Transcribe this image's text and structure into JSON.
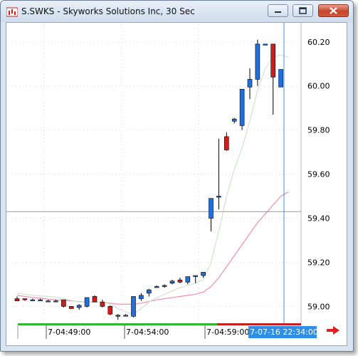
{
  "window": {
    "title": "S.SWKS - Skyworks Solutions Inc, 30 Sec",
    "controls": [
      "minimize",
      "maximize",
      "close"
    ]
  },
  "colors": {
    "up_candle": "#1f6fe0",
    "down_candle": "#d21c1c",
    "ma_fast": "#cfe3cf",
    "ma_slow": "#f08cb4",
    "crosshair_horizontal": "#8a8a8a",
    "cursor_vertical": "#3b8fd8",
    "session_bar_green": "#2dbb2d",
    "session_bar_red": "#c91f1f",
    "cursor_time_bg": "#2f8ee6"
  },
  "chart_data": {
    "type": "candlestick",
    "title": "S.SWKS - Skyworks Solutions Inc, 30 Sec",
    "y_ticks": [
      "60.20",
      "60.00",
      "59.80",
      "59.60",
      "59.40",
      "59.20",
      "59.00"
    ],
    "y_tick_values": [
      60.2,
      60.0,
      59.8,
      59.6,
      59.4,
      59.2,
      59.0
    ],
    "ylim": [
      58.93,
      60.28
    ],
    "x_tick_labels": [
      "7-04:49:00",
      "7-04:54:00",
      "7-04:59:00"
    ],
    "x_tick_index": [
      4,
      14,
      24
    ],
    "cursor_time_label": "7-07-16 22:34:00",
    "crosshair_price": 59.43,
    "candles": [
      {
        "o": 59.035,
        "h": 59.045,
        "l": 59.025,
        "c": 59.025
      },
      {
        "o": 59.035,
        "h": 59.035,
        "l": 59.025,
        "c": 59.03
      },
      {
        "o": 59.03,
        "h": 59.035,
        "l": 59.025,
        "c": 59.03
      },
      {
        "o": 59.03,
        "h": 59.035,
        "l": 59.025,
        "c": 59.03
      },
      {
        "o": 59.025,
        "h": 59.03,
        "l": 59.025,
        "c": 59.025
      },
      {
        "o": 59.025,
        "h": 59.03,
        "l": 59.02,
        "c": 59.025
      },
      {
        "o": 59.03,
        "h": 59.03,
        "l": 58.995,
        "c": 59.0
      },
      {
        "o": 59.0,
        "h": 59.0,
        "l": 58.99,
        "c": 58.99
      },
      {
        "o": 58.995,
        "h": 59.01,
        "l": 58.985,
        "c": 59.005
      },
      {
        "o": 59.0,
        "h": 59.04,
        "l": 58.995,
        "c": 59.04
      },
      {
        "o": 59.045,
        "h": 59.05,
        "l": 59.02,
        "c": 59.02
      },
      {
        "o": 59.02,
        "h": 59.03,
        "l": 58.995,
        "c": 59.0
      },
      {
        "o": 59.0,
        "h": 59.005,
        "l": 58.96,
        "c": 58.965
      },
      {
        "o": 58.96,
        "h": 58.965,
        "l": 58.94,
        "c": 58.955
      },
      {
        "o": 58.96,
        "h": 58.965,
        "l": 58.955,
        "c": 58.96
      },
      {
        "o": 58.955,
        "h": 59.045,
        "l": 58.95,
        "c": 59.045
      },
      {
        "o": 59.035,
        "h": 59.06,
        "l": 59.025,
        "c": 59.05
      },
      {
        "o": 59.06,
        "h": 59.08,
        "l": 59.045,
        "c": 59.075
      },
      {
        "o": 59.09,
        "h": 59.095,
        "l": 59.085,
        "c": 59.09
      },
      {
        "o": 59.09,
        "h": 59.1,
        "l": 59.085,
        "c": 59.095
      },
      {
        "o": 59.105,
        "h": 59.12,
        "l": 59.1,
        "c": 59.115
      },
      {
        "o": 59.12,
        "h": 59.13,
        "l": 59.105,
        "c": 59.11
      },
      {
        "o": 59.11,
        "h": 59.135,
        "l": 59.1,
        "c": 59.135
      },
      {
        "o": 59.135,
        "h": 59.14,
        "l": 59.105,
        "c": 59.14
      },
      {
        "o": 59.14,
        "h": 59.155,
        "l": 59.13,
        "c": 59.155
      },
      {
        "o": 59.4,
        "h": 59.49,
        "l": 59.34,
        "c": 59.49
      },
      {
        "o": 59.5,
        "h": 59.76,
        "l": 59.44,
        "c": 59.5
      },
      {
        "o": 59.77,
        "h": 59.79,
        "l": 59.705,
        "c": 59.71
      },
      {
        "o": 59.84,
        "h": 59.855,
        "l": 59.83,
        "c": 59.85
      },
      {
        "o": 59.82,
        "h": 59.985,
        "l": 59.8,
        "c": 59.985
      },
      {
        "o": 59.995,
        "h": 60.08,
        "l": 59.94,
        "c": 60.03
      },
      {
        "o": 60.03,
        "h": 60.21,
        "l": 60.0,
        "c": 60.19
      },
      {
        "o": 60.185,
        "h": 60.19,
        "l": 60.185,
        "c": 60.19
      },
      {
        "o": 60.19,
        "h": 60.19,
        "l": 59.87,
        "c": 60.04
      },
      {
        "o": 59.995,
        "h": 60.075,
        "l": 59.995,
        "c": 60.075
      }
    ],
    "ma_fast": [
      59.06,
      59.055,
      59.05,
      59.047,
      59.045,
      59.042,
      59.035,
      59.027,
      59.02,
      59.02,
      59.02,
      59.018,
      59.012,
      58.99,
      58.975,
      58.965,
      58.99,
      59.02,
      59.04,
      59.055,
      59.07,
      59.085,
      59.095,
      59.105,
      59.12,
      59.2,
      59.34,
      59.5,
      59.62,
      59.72,
      59.84,
      59.98,
      60.08,
      60.13,
      60.14,
      60.13
    ],
    "ma_slow": [
      59.05,
      59.045,
      59.04,
      59.037,
      59.033,
      59.03,
      59.028,
      59.025,
      59.022,
      59.02,
      59.02,
      59.018,
      59.015,
      59.01,
      59.01,
      59.01,
      59.015,
      59.022,
      59.03,
      59.035,
      59.04,
      59.045,
      59.05,
      59.055,
      59.065,
      59.09,
      59.13,
      59.18,
      59.23,
      59.28,
      59.33,
      59.38,
      59.42,
      59.46,
      59.5,
      59.52
    ]
  }
}
